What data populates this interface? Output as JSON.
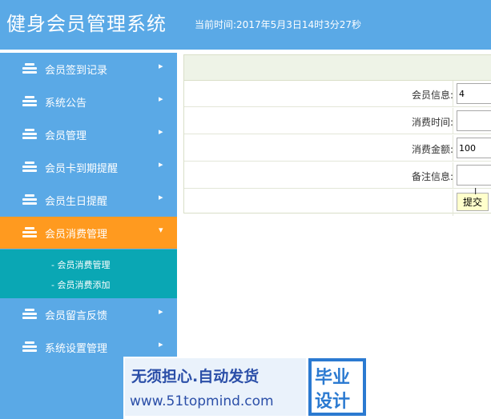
{
  "header": {
    "title": "健身会员管理系统",
    "time_text": "当前时间:2017年5月3日14时3分27秒"
  },
  "sidebar": {
    "items": [
      {
        "label": "会员签到记录",
        "icon": "database-icon",
        "arrow": "▸"
      },
      {
        "label": "系统公告",
        "icon": "database-icon",
        "arrow": "▸"
      },
      {
        "label": "会员管理",
        "icon": "database-icon",
        "arrow": "▸"
      },
      {
        "label": "会员卡到期提醒",
        "icon": "database-icon",
        "arrow": "▸"
      },
      {
        "label": "会员生日提醒",
        "icon": "database-icon",
        "arrow": "▸"
      },
      {
        "label": "会员消费管理",
        "icon": "database-icon",
        "arrow": "▾"
      },
      {
        "label": "会员留言反馈",
        "icon": "database-icon",
        "arrow": "▸"
      },
      {
        "label": "系统设置管理",
        "icon": "database-icon",
        "arrow": "▸"
      }
    ],
    "submenu": [
      {
        "label": "- 会员消费管理"
      },
      {
        "label": "- 会员消费添加"
      }
    ]
  },
  "form": {
    "fields": [
      {
        "label": "会员信息:",
        "value": "4"
      },
      {
        "label": "消费时间:",
        "value": ""
      },
      {
        "label": "消费金额:",
        "value": "100"
      },
      {
        "label": "备注信息:",
        "value": ""
      }
    ],
    "submit_label": "提交"
  },
  "watermark": {
    "line1": "无须担心.自动发货",
    "line2": "www.51topmind.com",
    "badge_line1": "毕业",
    "badge_line2": "设计"
  },
  "colors": {
    "header_bg": "#5aa9e6",
    "sidebar_bg": "#5aa9e6",
    "active_item_bg": "#ff9a1f",
    "submenu_bg": "#0aa7b4",
    "form_head_bg": "#eef3e7",
    "submit_bg": "#ffffcc"
  }
}
